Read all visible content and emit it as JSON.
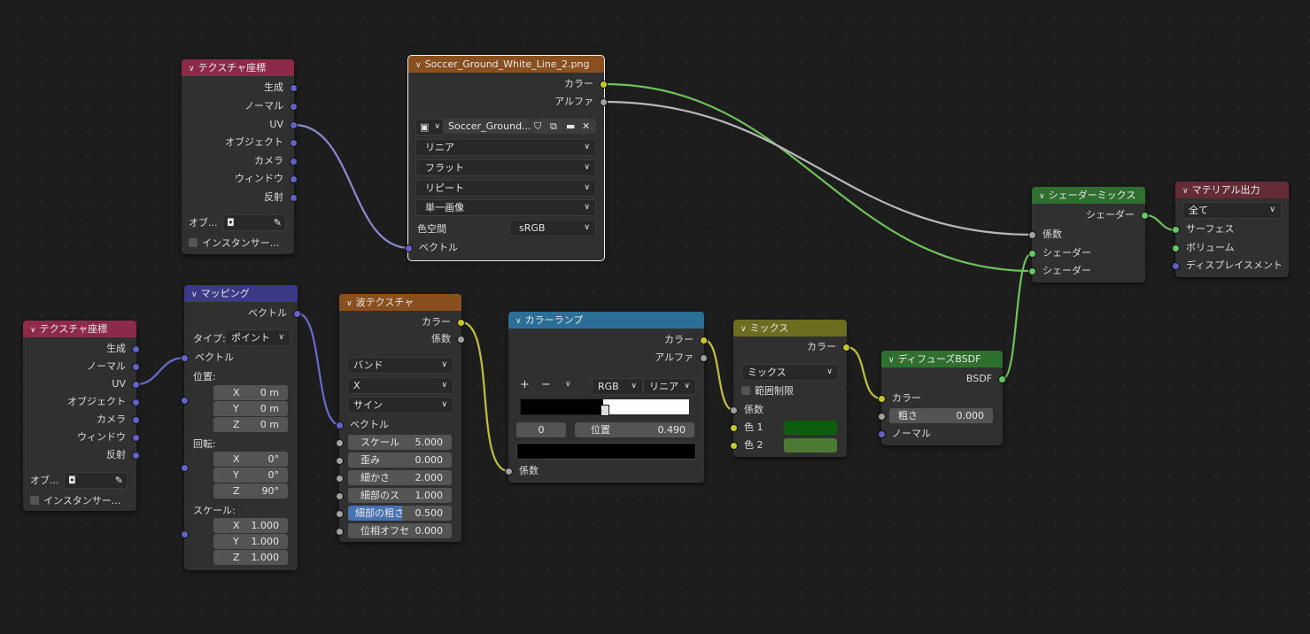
{
  "colors": {
    "texcoord": "#8d2a49",
    "mapping": "#3a3a86",
    "texture": "#8a4f1f",
    "converter": "#2b6f97",
    "mix": "#6d6d1f",
    "shader": "#2f6f2f",
    "output": "#632c36"
  },
  "texcoord1": {
    "title": "テクスチャ座標",
    "outputs": [
      "生成",
      "ノーマル",
      "UV",
      "オブジェクト",
      "カメラ",
      "ウィンドウ",
      "反射"
    ],
    "obj_label": "オブ...",
    "instancer": "インスタンサー..."
  },
  "texcoord2": {
    "title": "テクスチャ座標",
    "outputs": [
      "生成",
      "ノーマル",
      "UV",
      "オブジェクト",
      "カメラ",
      "ウィンドウ",
      "反射"
    ],
    "obj_label": "オブ...",
    "instancer": "インスタンサー..."
  },
  "image": {
    "title": "Soccer_Ground_White_Line_2.png",
    "out_color": "カラー",
    "out_alpha": "アルファ",
    "image_name": "Soccer_Ground...",
    "interp": "リニア",
    "projection": "フラット",
    "extension": "リピート",
    "source": "単一画像",
    "colorspace_label": "色空間",
    "colorspace": "sRGB",
    "in_vector": "ベクトル"
  },
  "mapping": {
    "title": "マッピング",
    "out_vector": "ベクトル",
    "type_label": "タイプ:",
    "type": "ポイント",
    "in_vector": "ベクトル",
    "loc_label": "位置:",
    "loc": [
      [
        "X",
        "0 m"
      ],
      [
        "Y",
        "0 m"
      ],
      [
        "Z",
        "0 m"
      ]
    ],
    "rot_label": "回転:",
    "rot": [
      [
        "X",
        "0°"
      ],
      [
        "Y",
        "0°"
      ],
      [
        "Z",
        "90°"
      ]
    ],
    "scale_label": "スケール:",
    "scale": [
      [
        "X",
        "1.000"
      ],
      [
        "Y",
        "1.000"
      ],
      [
        "Z",
        "1.000"
      ]
    ]
  },
  "wave": {
    "title": "波テクスチャ",
    "out_color": "カラー",
    "out_fac": "係数",
    "wave_type": "バンド",
    "direction": "X",
    "profile": "サイン",
    "in_vector": "ベクトル",
    "params": [
      [
        "スケール",
        "5.000"
      ],
      [
        "歪み",
        "0.000"
      ],
      [
        "細かさ",
        "2.000"
      ],
      [
        "細部のス",
        "1.000"
      ],
      [
        "細部の粗さ",
        "0.500"
      ],
      [
        "位相オフセ",
        "0.000"
      ]
    ]
  },
  "ramp": {
    "title": "カラーランプ",
    "out_color": "カラー",
    "out_alpha": "アルファ",
    "plus": "+",
    "minus": "−",
    "mode": "RGB",
    "interp": "リニア",
    "index": "0",
    "pos_label": "位置",
    "pos": "0.490",
    "in_fac": "係数"
  },
  "mix": {
    "title": "ミックス",
    "out_color": "カラー",
    "blend": "ミックス",
    "clamp": "範囲制限",
    "fac": "係数",
    "c1": "色 1",
    "c2": "色 2",
    "c1_color": "#0f5e0f",
    "c2_color": "#4c7a32"
  },
  "diffuse": {
    "title": "ディフューズBSDF",
    "out": "BSDF",
    "in_color": "カラー",
    "rough_label": "粗さ",
    "rough": "0.000",
    "normal": "ノーマル"
  },
  "shadermix": {
    "title": "シェーダーミックス",
    "out": "シェーダー",
    "fac": "係数",
    "s1": "シェーダー",
    "s2": "シェーダー"
  },
  "output": {
    "title": "マテリアル出力",
    "target": "全て",
    "surface": "サーフェス",
    "volume": "ボリューム",
    "disp": "ディスプレイスメント"
  }
}
